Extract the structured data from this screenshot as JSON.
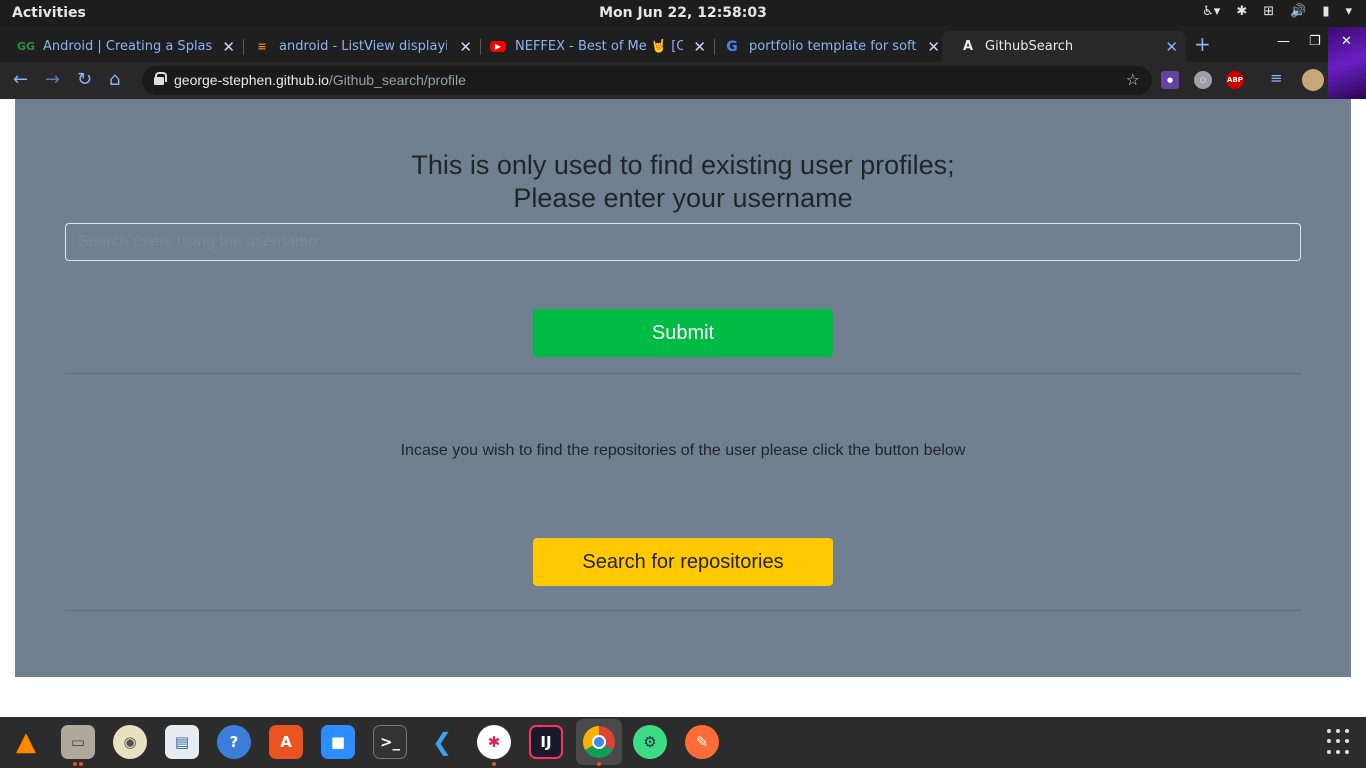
{
  "system_bar": {
    "activities": "Activities",
    "clock": "Mon Jun 22, 12:58:03",
    "tray_icons": [
      "accessibility-icon",
      "slack-tray-icon",
      "network-icon",
      "volume-icon",
      "battery-icon",
      "system-menu-icon"
    ]
  },
  "browser": {
    "tabs": [
      {
        "label": "Android | Creating a Splash S",
        "favicon": "GG"
      },
      {
        "label": "android - ListView displaying",
        "favicon": "SO"
      },
      {
        "label": "NEFFEX - Best of Me 🤘 [Cop",
        "favicon": "YT"
      },
      {
        "label": "portfolio template for softw",
        "favicon": "G"
      },
      {
        "label": "GithubSearch",
        "favicon": "A"
      }
    ],
    "new_tab": "+",
    "url_host": "george-stephen.github.io",
    "url_path": "/Github_search/profile",
    "extensions": [
      {
        "name": "twitch-extension-icon",
        "color": "#6441a5",
        "text": ""
      },
      {
        "name": "circle-extension-icon",
        "color": "#9aa0a6",
        "text": ""
      },
      {
        "name": "adblock-plus-icon",
        "color": "#d00000",
        "text": "ABP"
      }
    ]
  },
  "page": {
    "heading_line1": "This is only used to find existing user profiles;",
    "heading_line2": "Please enter your username",
    "search_placeholder": "Search users using the username",
    "submit_label": "Submit",
    "info_text": "Incase you wish to find the repositories of the user please click the button below",
    "repos_button_label": "Search for repositories"
  },
  "dock": {
    "apps": [
      "vlc-icon",
      "files-icon",
      "disks-icon",
      "document-viewer-icon",
      "help-icon",
      "software-center-icon",
      "zoom-icon",
      "terminal-icon",
      "vscode-icon",
      "slack-icon",
      "intellij-icon",
      "chrome-icon",
      "android-studio-icon",
      "postman-icon"
    ]
  }
}
